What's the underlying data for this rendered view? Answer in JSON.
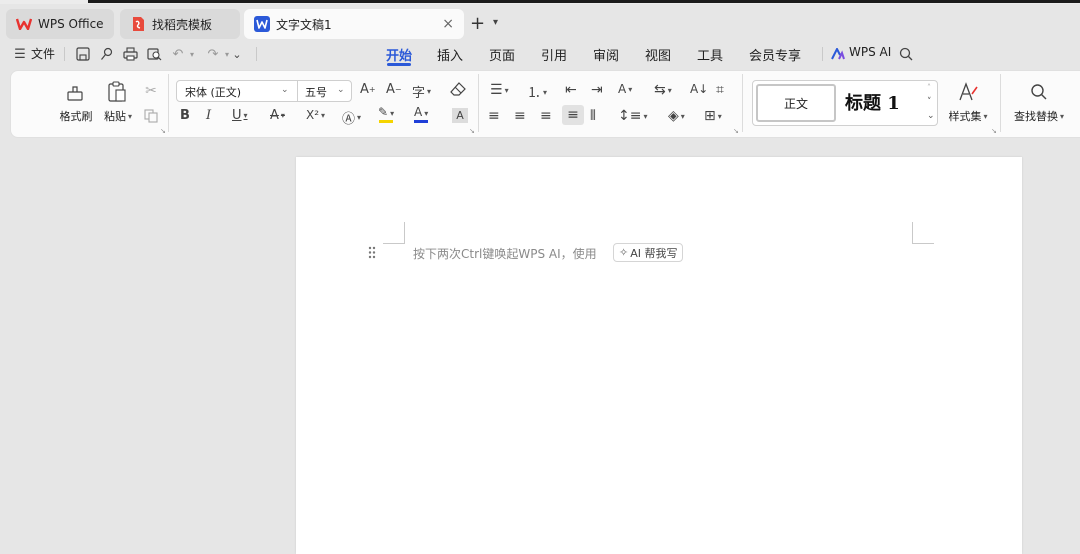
{
  "tabs": [
    {
      "label": "WPS Office",
      "icon": "wps-logo-icon",
      "color": "#e8322f"
    },
    {
      "label": "找稻壳模板",
      "icon": "docer-icon",
      "color": "#e84a3c"
    },
    {
      "label": "文字文稿1",
      "icon": "writer-doc-icon",
      "color": "#2b59d8",
      "active": true
    }
  ],
  "tab_close": "×",
  "new_tab": "+",
  "menu": {
    "file": "文件",
    "items": [
      "开始",
      "插入",
      "页面",
      "引用",
      "审阅",
      "视图",
      "工具",
      "会员专享"
    ],
    "active": "开始",
    "wps_ai": "WPS AI"
  },
  "ribbon": {
    "format_painter": "格式刷",
    "paste": "粘贴",
    "font_name": "宋体 (正文)",
    "font_size": "五号",
    "bold": "B",
    "italic": "I",
    "underline": "U",
    "strikethrough": "A",
    "superscript": "X²",
    "style_normal": "正文",
    "style_heading1": "标题  1",
    "style_set": "样式集",
    "find_replace": "查找替换"
  },
  "document": {
    "hint": "按下两次Ctrl键唤起WPS AI，使用",
    "ai_chip": "AI 帮我写"
  },
  "colors": {
    "accent": "#2b59d8",
    "wps_red": "#e8322f",
    "highlight_yellow": "#f5d400",
    "font_color_blue": "#1f3fd8"
  }
}
